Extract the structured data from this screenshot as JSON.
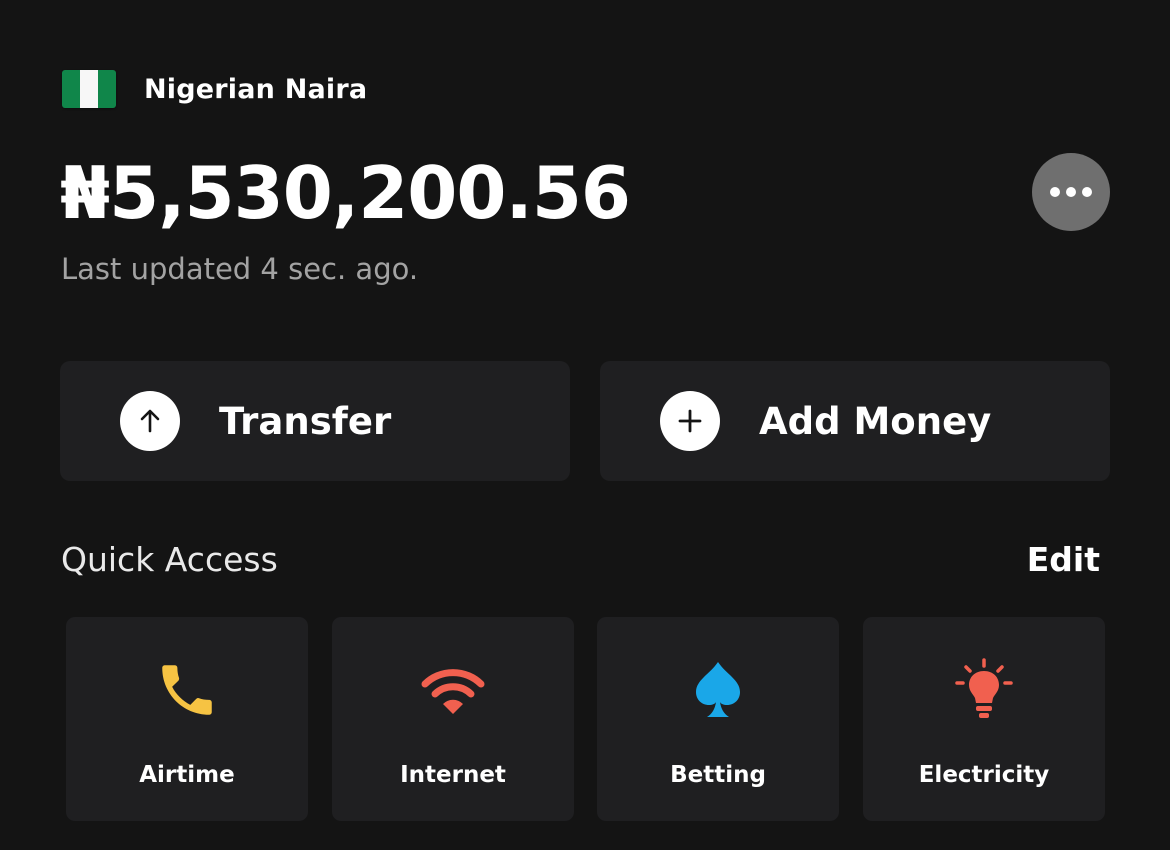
{
  "account": {
    "flag_icon": "nigeria-flag-icon",
    "currency_name": "Nigerian Naira",
    "balance": "₦5,530,200.56",
    "last_updated": "Last updated 4 sec. ago.",
    "more_icon": "more-dots-icon"
  },
  "actions": [
    {
      "label": "Transfer",
      "icon": "arrow-up-icon"
    },
    {
      "label": "Add Money",
      "icon": "plus-icon"
    }
  ],
  "quick_access": {
    "title": "Quick Access",
    "edit_label": "Edit",
    "items": [
      {
        "label": "Airtime",
        "icon": "phone-icon",
        "color": "#f6c343"
      },
      {
        "label": "Internet",
        "icon": "wifi-icon",
        "color": "#f1604f"
      },
      {
        "label": "Betting",
        "icon": "spade-icon",
        "color": "#1aa7e8"
      },
      {
        "label": "Electricity",
        "icon": "lightbulb-icon",
        "color": "#f1604f"
      }
    ]
  },
  "colors": {
    "background": "#141414",
    "card": "#1f1f21",
    "flag_green": "#10864a"
  }
}
